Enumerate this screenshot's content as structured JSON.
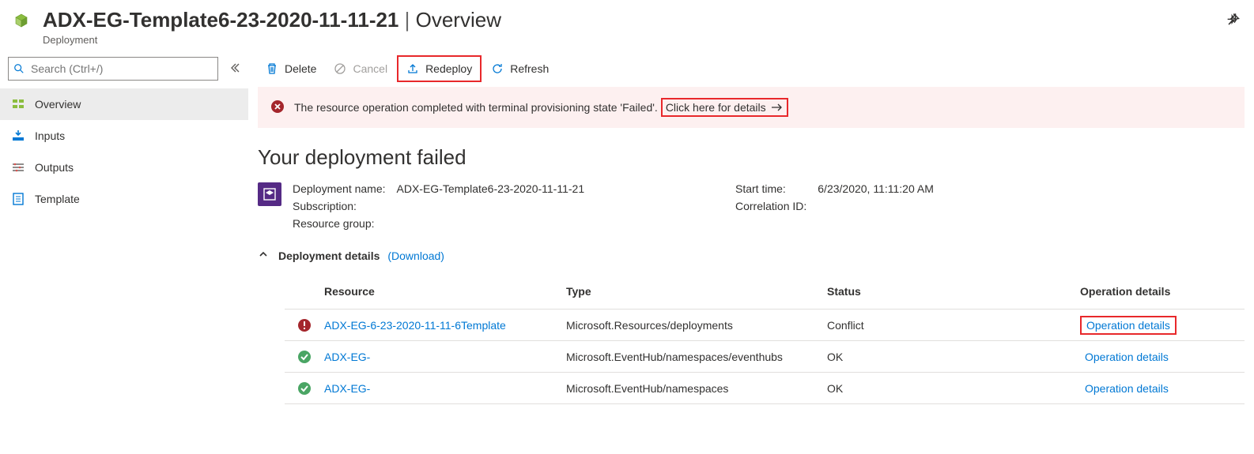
{
  "header": {
    "title_prefix": "ADX-EG-Template6-23-2020-11-11-21",
    "title_suffix": "Overview",
    "breadcrumb": "Deployment"
  },
  "search": {
    "placeholder": "Search (Ctrl+/)"
  },
  "nav": {
    "overview": "Overview",
    "inputs": "Inputs",
    "outputs": "Outputs",
    "template": "Template"
  },
  "toolbar": {
    "delete": "Delete",
    "cancel": "Cancel",
    "redeploy": "Redeploy",
    "refresh": "Refresh"
  },
  "alert": {
    "text": "The resource operation completed with terminal provisioning state 'Failed'.",
    "link": "Click here for details"
  },
  "heading": "Your deployment failed",
  "meta": {
    "left": {
      "l1": "Deployment name:",
      "l2": "Subscription:",
      "l3": "Resource group:",
      "v1": "ADX-EG-Template6-23-2020-11-11-21",
      "v2": "",
      "v3": ""
    },
    "right": {
      "l1": "Start time:",
      "l2": "Correlation ID:",
      "v1": "6/23/2020, 11:11:20 AM",
      "v2": ""
    }
  },
  "details": {
    "title": "Deployment details",
    "download": "(Download)"
  },
  "table": {
    "headers": {
      "resource": "Resource",
      "type": "Type",
      "status": "Status",
      "op": "Operation details"
    },
    "rows": [
      {
        "status_icon": "error",
        "resource": "ADX-EG-6-23-2020-11-11-6Template",
        "type": "Microsoft.Resources/deployments",
        "status": "Conflict",
        "op": "Operation details",
        "op_boxed": true
      },
      {
        "status_icon": "ok",
        "resource": "ADX-EG-",
        "type": "Microsoft.EventHub/namespaces/eventhubs",
        "status": "OK",
        "op": "Operation details",
        "op_boxed": false
      },
      {
        "status_icon": "ok",
        "resource": "ADX-EG-",
        "type": "Microsoft.EventHub/namespaces",
        "status": "OK",
        "op": "Operation details",
        "op_boxed": false
      }
    ]
  }
}
